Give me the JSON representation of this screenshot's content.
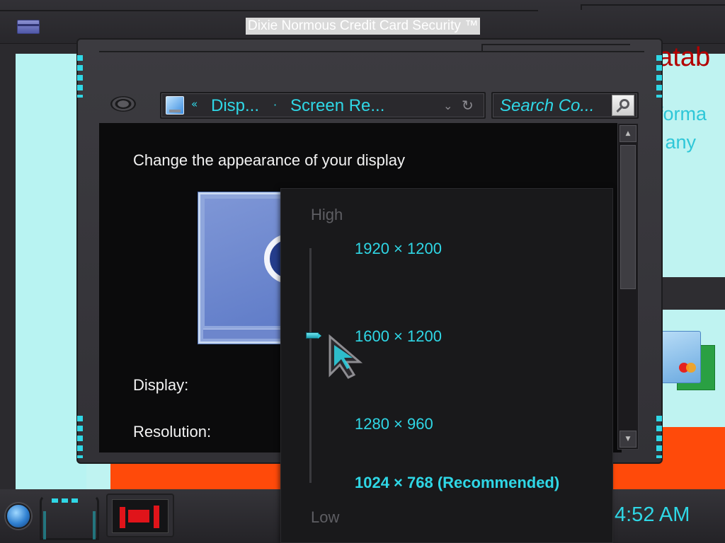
{
  "background_app": {
    "title": "Dixie Normous Credit Card Security ™",
    "heading_fragment": "datab",
    "line1_fragment": "informa",
    "line2_fragment": "e if any",
    "colors": {
      "cyan_bg": "#bff3f1",
      "orange": "#ff4a0a",
      "red_text": "#b30000"
    }
  },
  "window": {
    "address_bar": {
      "chevron": "«",
      "crumbs": [
        "Disp...",
        "Screen Re..."
      ],
      "separator": "·",
      "dropdown_icon": "chevron-down-icon",
      "refresh_icon": "refresh-icon"
    },
    "search": {
      "placeholder": "Search Co...",
      "icon": "search-icon"
    },
    "content": {
      "heading": "Change the appearance of your display",
      "display_label": "Display:",
      "resolution_label": "Resolution:"
    }
  },
  "resolution_popup": {
    "high_label": "High",
    "low_label": "Low",
    "options": [
      "1920 × 1200",
      "1600 × 1200",
      "1280 × 960",
      "1024 × 768 (Recommended)"
    ],
    "selected_option": "1600 × 1200"
  },
  "taskbar": {
    "clock": "4:52 AM"
  },
  "theme": {
    "accent": "#2fd7e6",
    "window_bg": "#3c3b40",
    "content_bg": "#0b0b0c"
  }
}
